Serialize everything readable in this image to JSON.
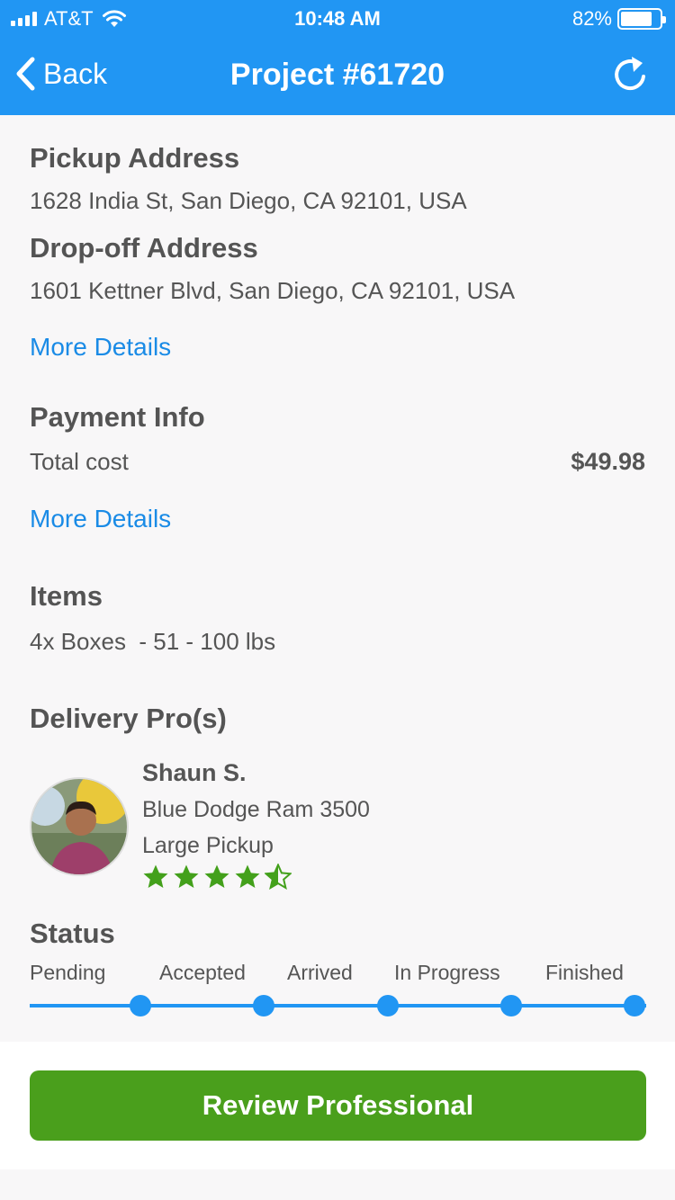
{
  "status_bar": {
    "carrier": "AT&T",
    "time": "10:48 AM",
    "battery": "82%",
    "battery_level": 0.82
  },
  "nav": {
    "back_label": "Back",
    "title": "Project #61720"
  },
  "pickup": {
    "heading": "Pickup Address",
    "address": "1628 India St, San Diego, CA 92101, USA"
  },
  "dropoff": {
    "heading": "Drop-off Address",
    "address": "1601 Kettner Blvd, San Diego, CA 92101, USA"
  },
  "address_more_details": "More Details",
  "payment": {
    "heading": "Payment Info",
    "total_label": "Total cost",
    "total_value": "$49.98",
    "more_details": "More Details"
  },
  "items": {
    "heading": "Items",
    "line": "4x Boxes  - 51 - 100 lbs"
  },
  "delivery": {
    "heading": "Delivery Pro(s)",
    "pro": {
      "name": "Shaun S.",
      "vehicle": "Blue Dodge Ram 3500",
      "vehicle_type": "Large Pickup",
      "rating": 4.5
    }
  },
  "status": {
    "heading": "Status",
    "steps": [
      "Pending",
      "Accepted",
      "Arrived",
      "In Progress",
      "Finished"
    ]
  },
  "footer": {
    "review_button": "Review Professional"
  },
  "colors": {
    "header": "#2196f3",
    "link": "#1a8be6",
    "accent_green": "#4a9f1c",
    "star_green": "#43a01b"
  },
  "icons": [
    "signal-icon",
    "wifi-icon",
    "battery-icon",
    "chevron-left-icon",
    "refresh-icon",
    "star-icon",
    "half-star-icon"
  ]
}
